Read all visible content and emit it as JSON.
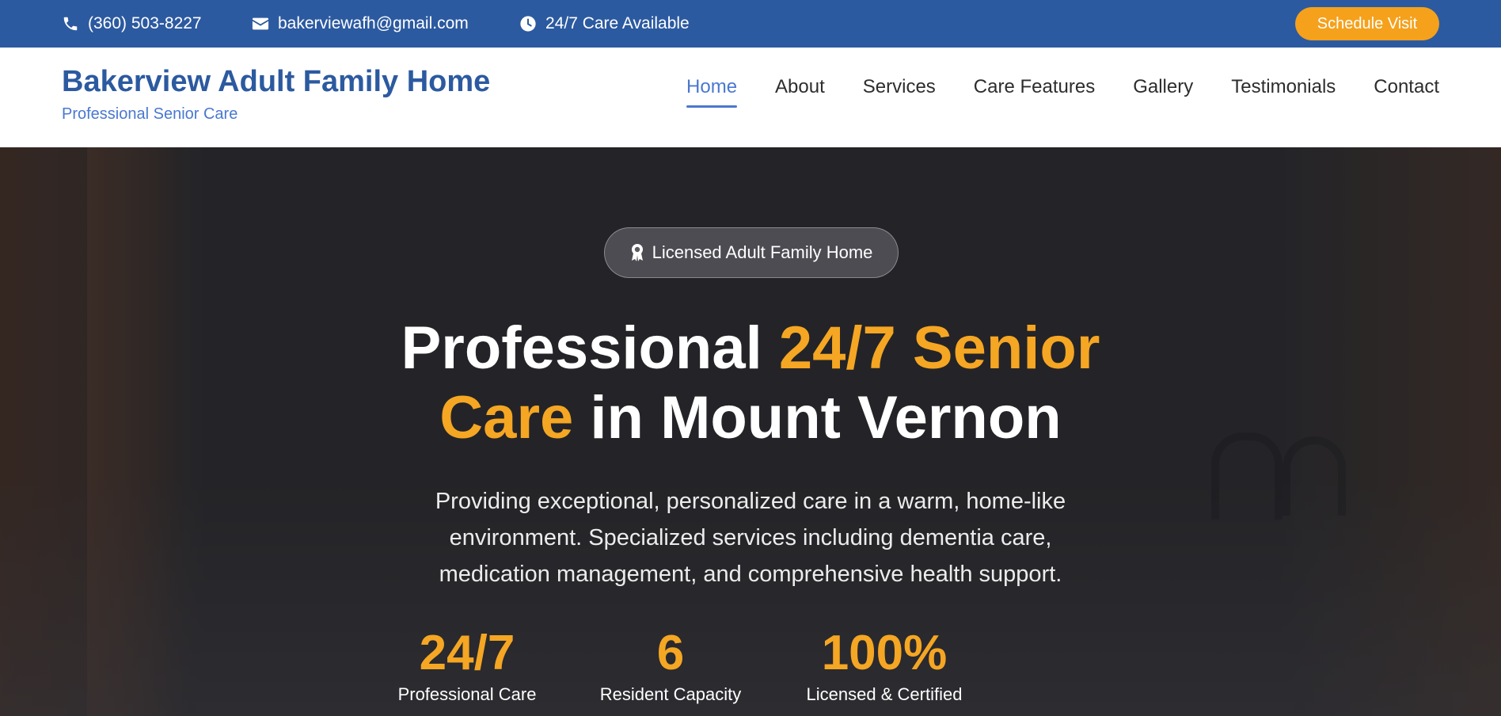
{
  "topbar": {
    "phone": "(360) 503-8227",
    "email": "bakerviewafh@gmail.com",
    "hours": "24/7 Care Available",
    "schedule_label": "Schedule Visit",
    "icons": [
      "phone-icon",
      "envelope-icon",
      "clock-icon"
    ]
  },
  "header": {
    "title": "Bakerview Adult Family Home",
    "subtitle": "Professional Senior Care"
  },
  "nav": {
    "items": [
      {
        "label": "Home",
        "active": true
      },
      {
        "label": "About",
        "active": false
      },
      {
        "label": "Services",
        "active": false
      },
      {
        "label": "Care Features",
        "active": false
      },
      {
        "label": "Gallery",
        "active": false
      },
      {
        "label": "Testimonials",
        "active": false
      },
      {
        "label": "Contact",
        "active": false
      }
    ]
  },
  "hero": {
    "badge": "Licensed Adult Family Home",
    "title_part1": "Professional ",
    "title_highlight1": "24/7 Senior",
    "title_highlight2": "Care",
    "title_part2": " in Mount Vernon",
    "description": "Providing exceptional, personalized care in a warm, home-like environment. Specialized services including dementia care, medication management, and comprehensive health support.",
    "stats": [
      {
        "value": "24/7",
        "label": "Professional Care"
      },
      {
        "value": "6",
        "label": "Resident Capacity"
      },
      {
        "value": "100%",
        "label": "Licensed & Certified"
      }
    ]
  },
  "colors": {
    "primary": "#2c5aa0",
    "accent": "#f5a623",
    "nav_active": "#4a78d0"
  }
}
